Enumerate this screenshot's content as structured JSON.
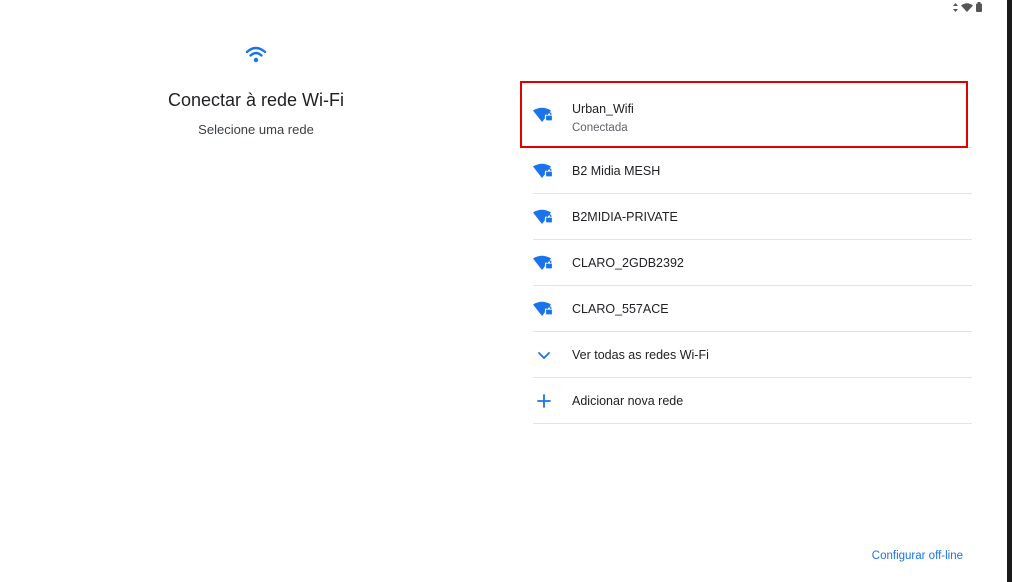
{
  "status_bar": {
    "icons": [
      "data-arrows-icon",
      "wifi-status-icon",
      "battery-icon"
    ]
  },
  "header": {
    "icon": "wifi-icon",
    "title": "Conectar à rede Wi-Fi",
    "subtitle": "Selecione uma rede"
  },
  "networks": [
    {
      "name": "Urban_Wifi",
      "status": "Conectada",
      "icon": "wifi-lock-icon"
    },
    {
      "name": "B2 Midia MESH",
      "icon": "wifi-lock-icon"
    },
    {
      "name": "B2MIDIA-PRIVATE",
      "icon": "wifi-lock-icon"
    },
    {
      "name": "CLARO_2GDB2392",
      "icon": "wifi-lock-icon"
    },
    {
      "name": "CLARO_557ACE",
      "icon": "wifi-lock-icon"
    }
  ],
  "actions": {
    "see_all": {
      "label": "Ver todas as redes Wi-Fi",
      "icon": "chevron-down-icon"
    },
    "add_network": {
      "label": "Adicionar nova rede",
      "icon": "plus-icon"
    }
  },
  "footer": {
    "offline_label": "Configurar off-line"
  },
  "colors": {
    "accent": "#1a73e8",
    "highlight": "#e00000"
  }
}
